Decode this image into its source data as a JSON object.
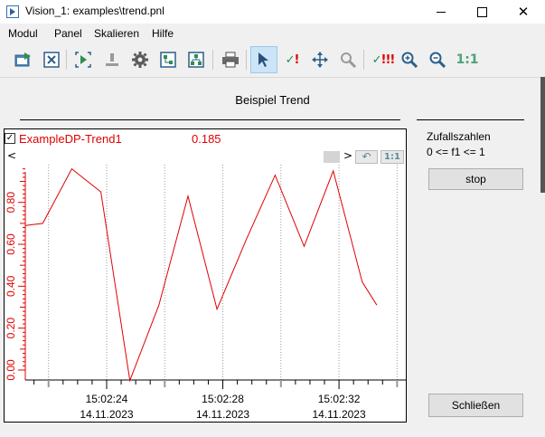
{
  "window": {
    "title": "Vision_1: examples\\trend.pnl"
  },
  "menu": [
    "Modul",
    "Panel",
    "Skalieren",
    "Hilfe"
  ],
  "toolbar": {
    "zoom_reset_label": "1:1"
  },
  "panel": {
    "title": "Beispiel Trend"
  },
  "trend": {
    "curve_name": "ExampleDP-Trend1",
    "curve_value": "0.185",
    "curve_color": "#e00000",
    "nav_left": "<",
    "nav_right": ">",
    "one_to_one": "1:1"
  },
  "side": {
    "caption": "Zufallszahlen",
    "range": "0 <= f1 <= 1",
    "stop_label": "stop",
    "close_label": "Schließen"
  },
  "chart_data": {
    "type": "line",
    "y_ticks": [
      "0.00",
      "0.20",
      "0.40",
      "0.60",
      "0.80"
    ],
    "ylim": [
      0,
      0.98
    ],
    "x_time_labels": [
      "15:02:24",
      "15:02:28",
      "15:02:32"
    ],
    "x_date_labels": [
      "14.11.2023",
      "14.11.2023",
      "14.11.2023"
    ],
    "x_time_values": [
      24,
      28,
      32
    ],
    "xlim": [
      21.2,
      34.3
    ],
    "grid": true,
    "series": [
      {
        "color": "#e00000",
        "points": [
          [
            21.2,
            0.69
          ],
          [
            21.8,
            0.7
          ],
          [
            22.8,
            0.96
          ],
          [
            23.8,
            0.85
          ],
          [
            24.8,
            -0.05
          ],
          [
            25.8,
            0.31
          ],
          [
            26.8,
            0.83
          ],
          [
            27.8,
            0.29
          ],
          [
            28.8,
            0.62
          ],
          [
            29.8,
            0.93
          ],
          [
            30.8,
            0.59
          ],
          [
            31.8,
            0.95
          ],
          [
            32.8,
            0.42
          ],
          [
            33.3,
            0.31
          ]
        ]
      }
    ]
  }
}
